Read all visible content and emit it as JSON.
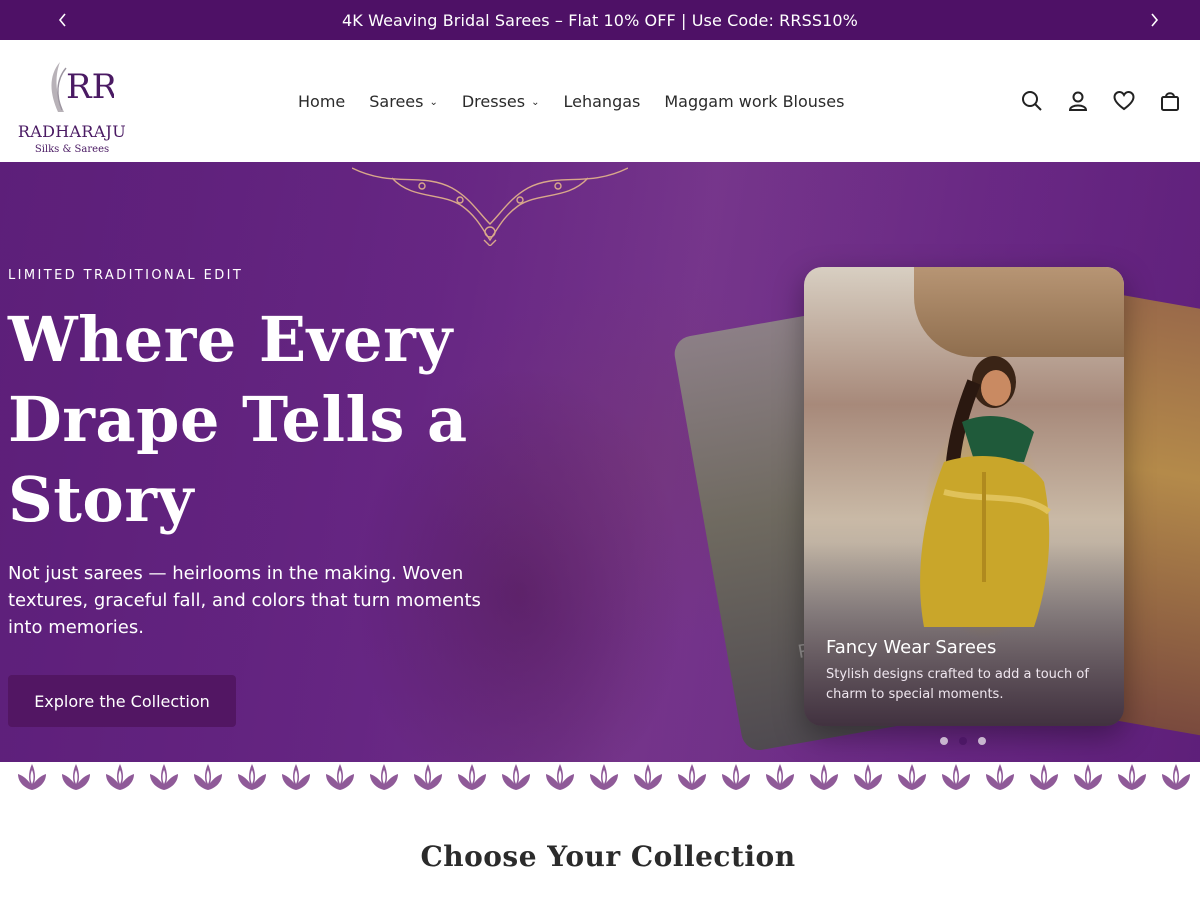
{
  "announcement": {
    "text": "4K Weaving Bridal Sarees – Flat 10% OFF | Use Code: RRSS10%",
    "prev_icon": "chevron-left-icon",
    "next_icon": "chevron-right-icon"
  },
  "brand": {
    "monogram": "RR",
    "name": "RADHARAJU",
    "tagline": "Silks & Sarees",
    "color": "#4a1a63"
  },
  "nav": {
    "items": [
      {
        "label": "Home",
        "has_dropdown": false
      },
      {
        "label": "Sarees",
        "has_dropdown": true
      },
      {
        "label": "Dresses",
        "has_dropdown": true
      },
      {
        "label": "Lehangas",
        "has_dropdown": false
      },
      {
        "label": "Maggam work Blouses",
        "has_dropdown": false
      }
    ],
    "dropdown_glyph": "⌄"
  },
  "header_icons": [
    "search-icon",
    "account-icon",
    "wishlist-icon",
    "cart-icon"
  ],
  "hero": {
    "eyebrow": "LIMITED TRADITIONAL EDIT",
    "title": "Where Every Drape Tells a Story",
    "description": "Not just sarees — heirlooms in the making. Woven textures, graceful fall, and colors that turn moments into memories.",
    "cta": "Explore the Collection",
    "slide_card": {
      "title": "Fancy Wear Sarees",
      "description": "Stylish designs crafted to add a touch of charm to special moments."
    },
    "slide_count": 3,
    "active_slide": 2,
    "colors": {
      "primary": "#521663",
      "accent": "#4e1166"
    }
  },
  "section": {
    "title": "Choose Your Collection"
  }
}
